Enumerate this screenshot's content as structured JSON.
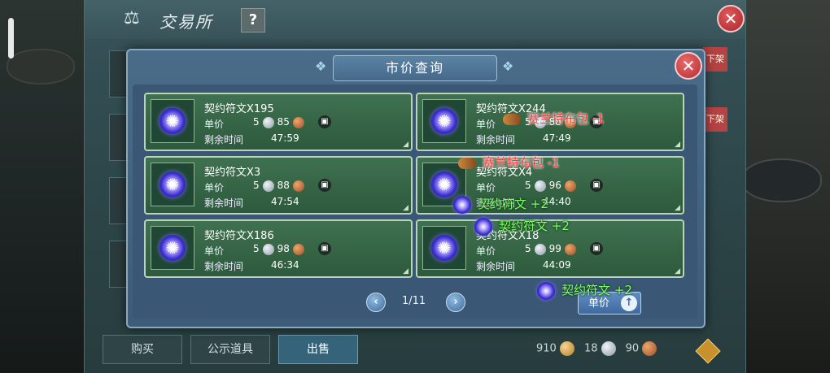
{
  "window": {
    "title": "交易所",
    "help_label": "?",
    "close_label": "✕",
    "side_tag": "下架"
  },
  "bottom": {
    "tabs": [
      "购买",
      "公示道具",
      "出售"
    ],
    "currency": {
      "gold": "910",
      "silver": "18",
      "copper": "90"
    }
  },
  "dialog": {
    "title": "市价查询",
    "close_label": "✕",
    "price_label": "单价",
    "time_label": "剩余时间",
    "items": [
      {
        "name": "契约符文X195",
        "price_silver": "5",
        "price_copper": "85",
        "time": "47:59"
      },
      {
        "name": "契约符文X244",
        "price_silver": "5",
        "price_copper": "88",
        "time": "47:49"
      },
      {
        "name": "契约符文X3",
        "price_silver": "5",
        "price_copper": "88",
        "time": "47:54"
      },
      {
        "name": "契约符文X4",
        "price_silver": "5",
        "price_copper": "96",
        "time": "44:40"
      },
      {
        "name": "契约符文X186",
        "price_silver": "5",
        "price_copper": "98",
        "time": "46:34"
      },
      {
        "name": "契约符文X18",
        "price_silver": "5",
        "price_copper": "99",
        "time": "44:09"
      }
    ],
    "pager": {
      "text": "1/11",
      "prev": "‹",
      "next": "›"
    },
    "sort_label": "单价",
    "sort_arrow": "↑"
  },
  "toasts": [
    {
      "text": "赛兰特布包 -1",
      "color": "red"
    },
    {
      "text": "赛兰特布包 -1",
      "color": "red"
    },
    {
      "text": "契约符文 +2",
      "color": "green"
    },
    {
      "text": "契约符文 +2",
      "color": "green"
    },
    {
      "text": "契约符文 +2",
      "color": "green"
    }
  ]
}
